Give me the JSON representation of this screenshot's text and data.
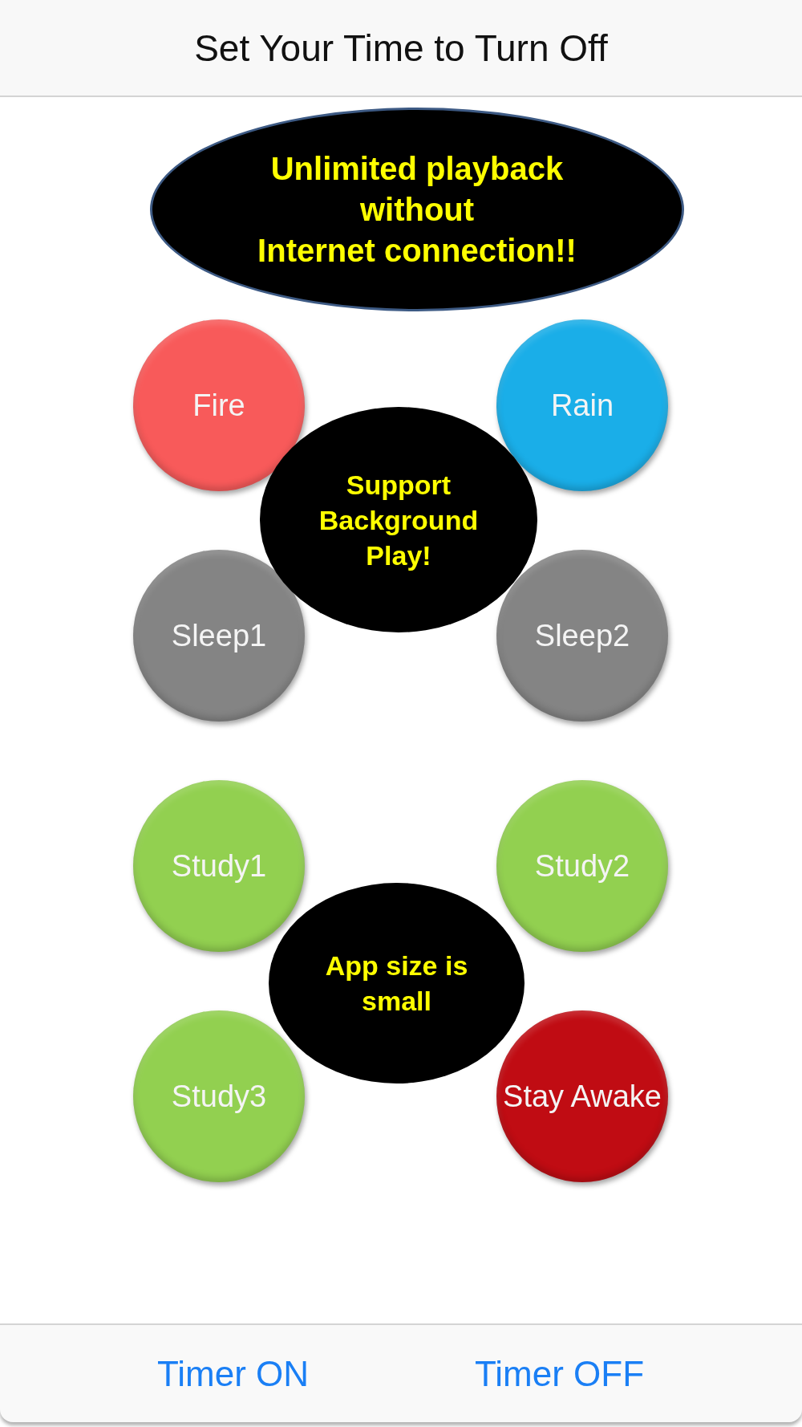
{
  "header": {
    "title": "Set Your Time to Turn Off"
  },
  "banner": {
    "text": "Unlimited playback\nwithout\nInternet connection!!"
  },
  "groups": [
    {
      "circles": [
        {
          "label": "Fire",
          "color": "#f85a5a"
        },
        {
          "label": "Rain",
          "color": "#1aaee8"
        },
        {
          "label": "Sleep1",
          "color": "#848484"
        },
        {
          "label": "Sleep2",
          "color": "#848484"
        }
      ],
      "callout": "Support\nBackground\nPlay!"
    },
    {
      "circles": [
        {
          "label": "Study1",
          "color": "#92d050"
        },
        {
          "label": "Study2",
          "color": "#92d050"
        },
        {
          "label": "Study3",
          "color": "#92d050"
        },
        {
          "label": "Stay Awake",
          "color": "#c00c13"
        }
      ],
      "callout": "App size is\nsmall"
    }
  ],
  "toolbar": {
    "buttons": [
      "Timer ON",
      "Timer OFF"
    ]
  }
}
